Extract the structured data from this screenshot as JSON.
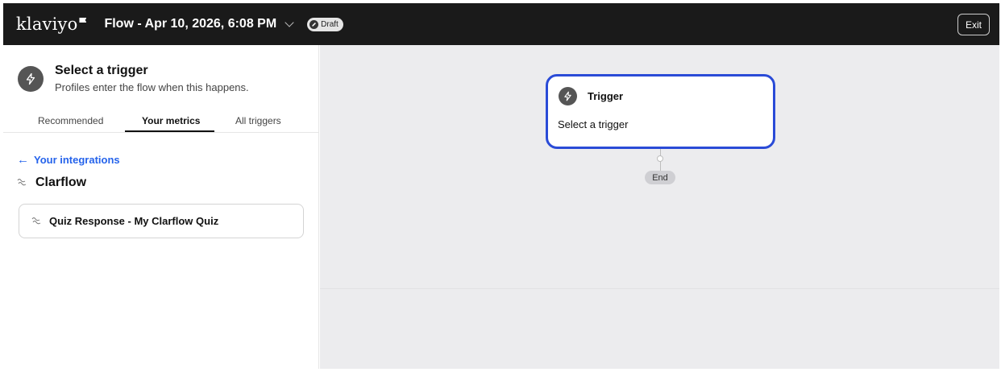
{
  "header": {
    "logo": "klaviyo",
    "flow_title": "Flow - Apr 10, 2026, 6:08 PM",
    "draft_badge": "Draft",
    "exit_label": "Exit"
  },
  "panel": {
    "title": "Select a trigger",
    "subtitle": "Profiles enter the flow when this happens.",
    "tabs": [
      {
        "label": "Recommended",
        "active": false
      },
      {
        "label": "Your metrics",
        "active": true
      },
      {
        "label": "All triggers",
        "active": false
      }
    ],
    "back_link": "Your integrations",
    "group_name": "Clarflow",
    "metrics": [
      {
        "label": "Quiz Response - My Clarflow Quiz"
      }
    ]
  },
  "canvas": {
    "trigger_card": {
      "title": "Trigger",
      "subtitle": "Select a trigger"
    },
    "end_label": "End"
  },
  "colors": {
    "topbar_bg": "#1a1a1a",
    "accent_blue": "#2a4bd7",
    "link_blue": "#2563eb",
    "canvas_bg": "#ececee"
  },
  "icons": {
    "trigger": "lightning-icon",
    "integration": "clarflow-logo-icon",
    "back": "arrow-left-icon",
    "flow_menu": "chevron-down-icon",
    "draft": "draft-icon"
  }
}
